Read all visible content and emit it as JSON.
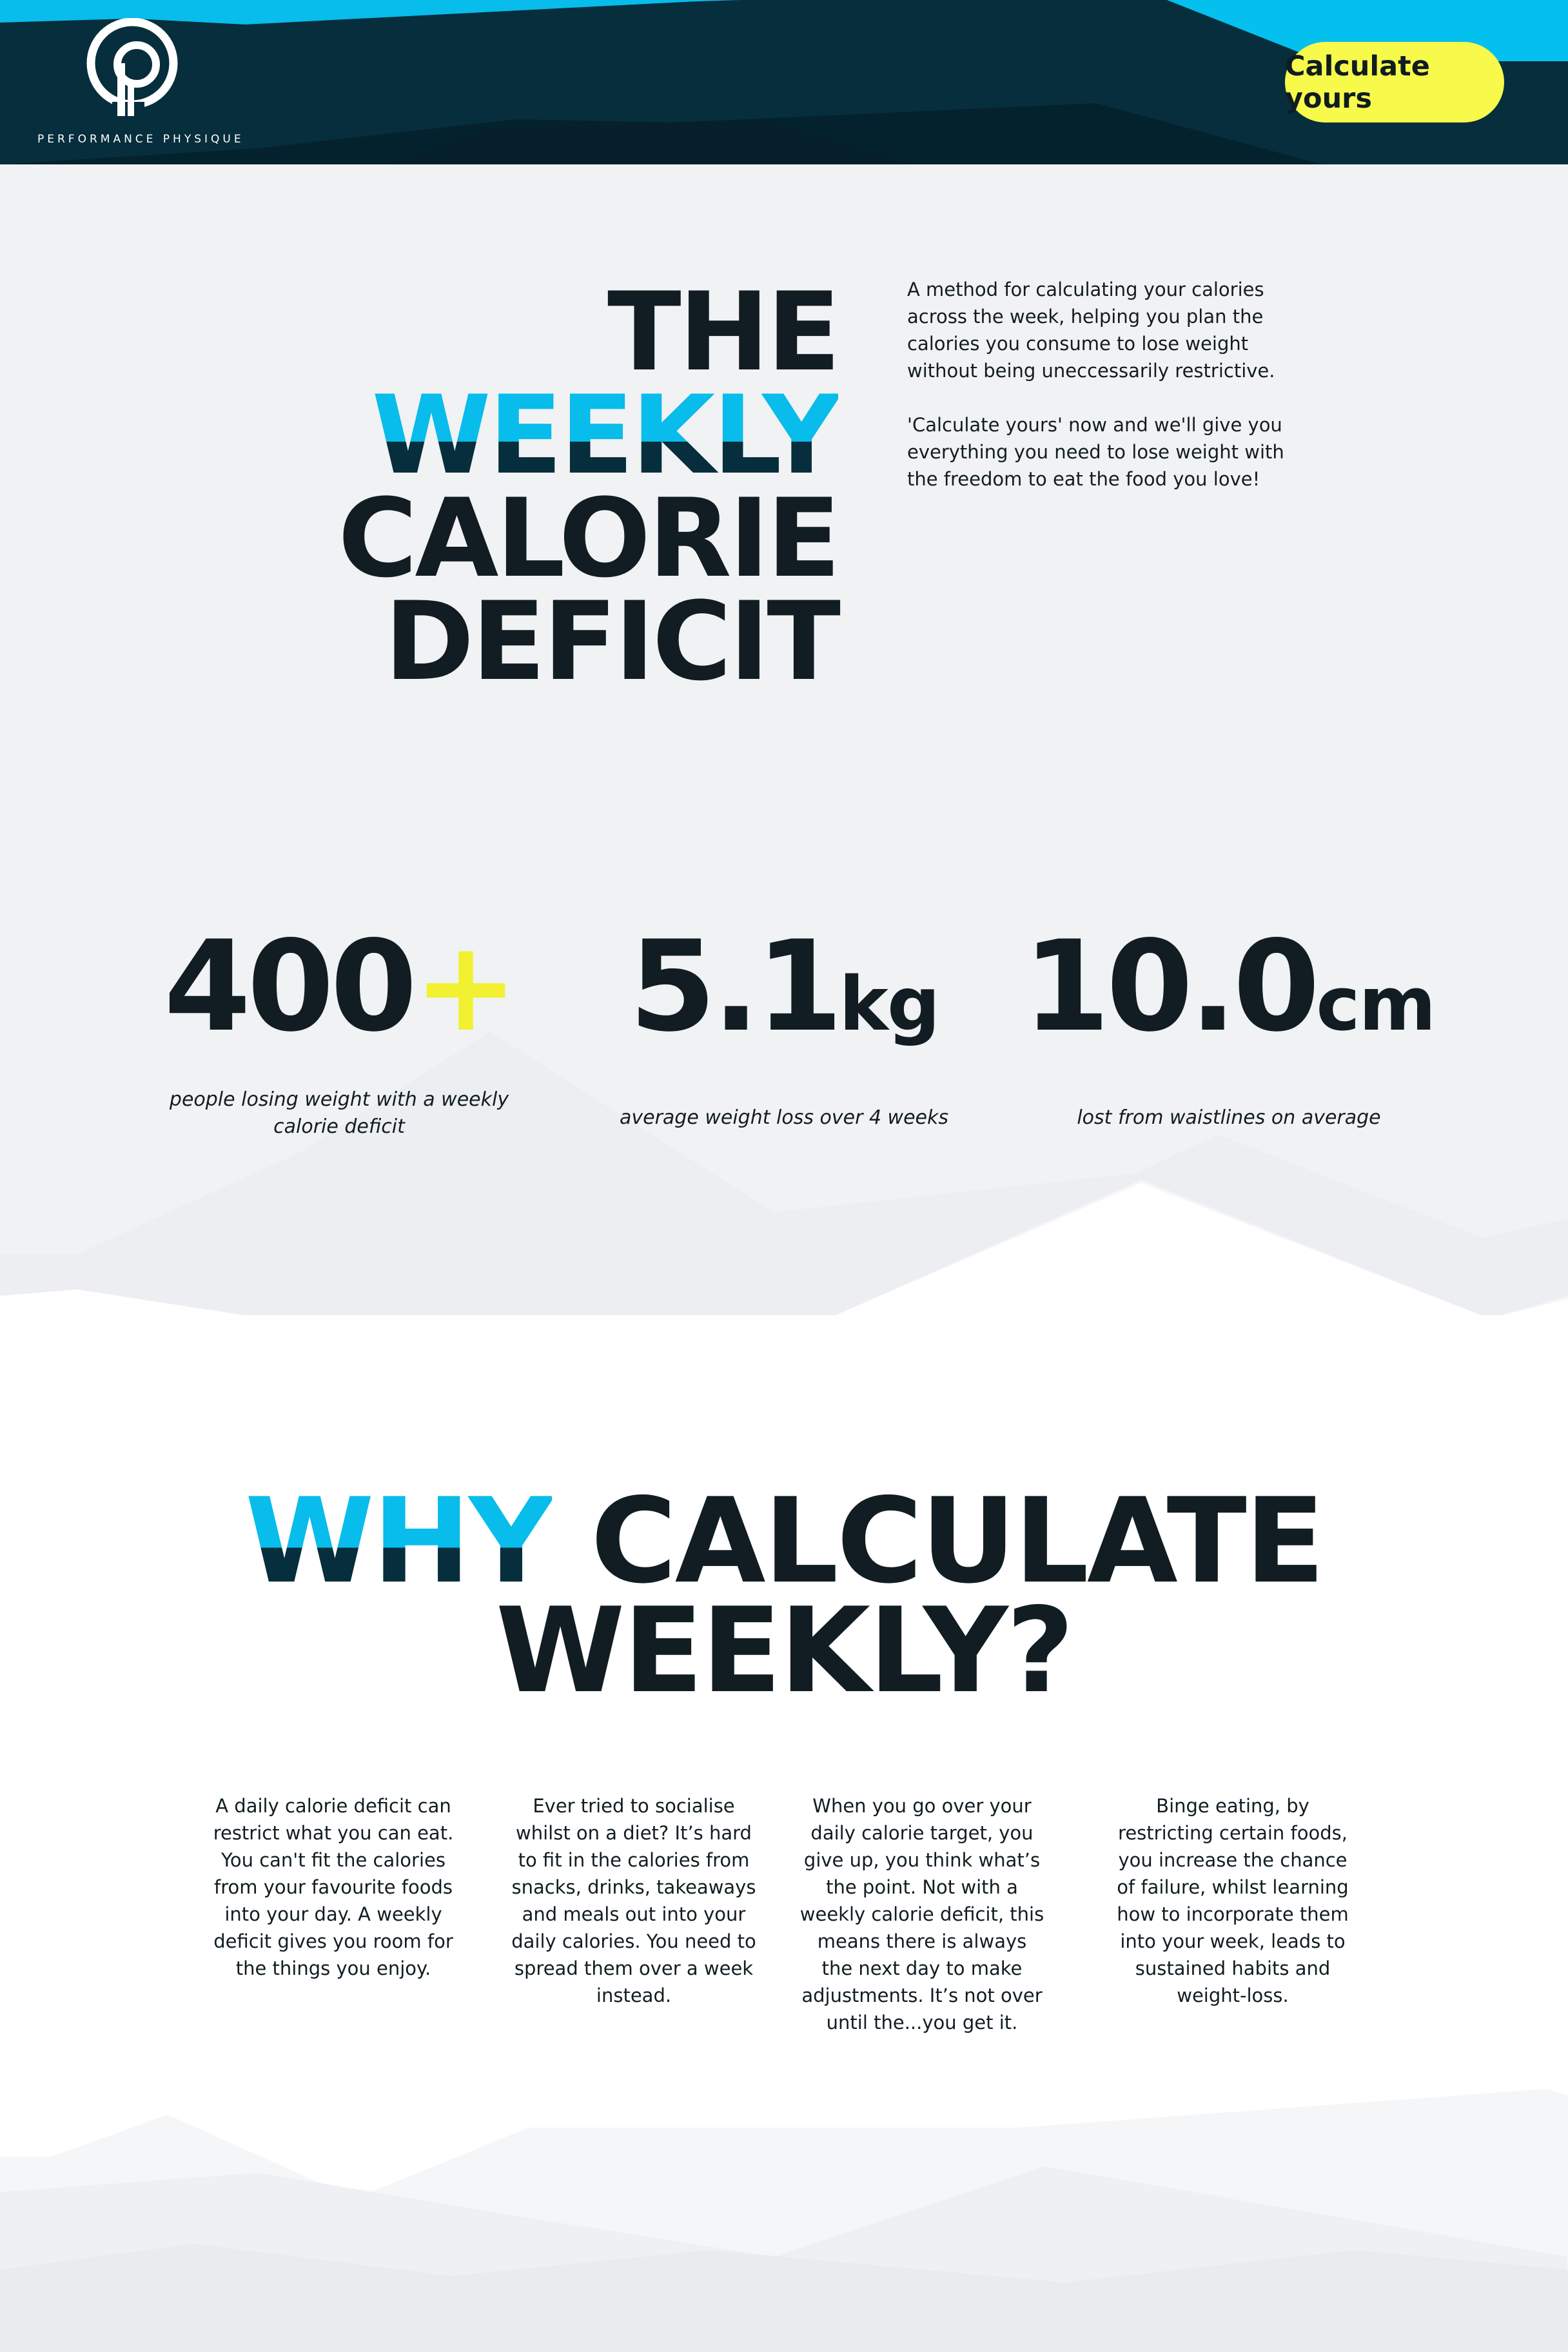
{
  "header": {
    "logo_text": "PERFORMANCE PHYSIQUE",
    "cta_label": "Calculate yours"
  },
  "hero": {
    "title_line1": "THE",
    "title_line2": "WEEKLY",
    "title_line3": "CALORIE",
    "title_line4": "DEFICIT",
    "paragraph1": "A method for calculating your calories across the week, helping you plan the calories you consume to lose weight without being uneccessarily restrictive.",
    "paragraph2": "'Calculate yours' now and we'll give you everything you need to lose weight with the freedom to eat the food you love!"
  },
  "stats": [
    {
      "value": "400",
      "suffix": "+",
      "caption": "people losing weight with a weekly calorie deficit"
    },
    {
      "value": "5.1",
      "suffix": "kg",
      "caption": "average weight loss over 4 weeks"
    },
    {
      "value": "10.0",
      "suffix": "cm",
      "caption": "lost from waistlines on average"
    }
  ],
  "why": {
    "title_highlight": "WHY",
    "title_rest": "CALCULATE",
    "title_line2": "WEEKLY?",
    "columns": [
      "A daily calorie deficit can restrict what you can eat. You can't fit the calories from your favourite foods into your day. A weekly deficit gives you room for the things you enjoy.",
      "Ever tried to socialise whilst on a diet? It’s hard to fit in the calories from snacks, drinks, takeaways and meals out into your daily calories. You need to spread them over a week instead.",
      "When you go over your daily calorie target, you give up, you think what’s the point. Not with a weekly calorie deficit, this means there is always the next day to make adjustments. It’s not over until the...you get it.",
      "Binge eating, by restricting certain foods, you increase the chance of failure, whilst learning how to incorporate them into your week, leads to sustained habits and weight-loss."
    ]
  },
  "colors": {
    "header_dark": "#062e3c",
    "accent_blue": "#08bceb",
    "accent_yellow": "#f7fa4a",
    "text_dark": "#111d22",
    "hero_bg": "#f1f2f4"
  },
  "icons": [
    "performance-physique-logo-icon"
  ]
}
